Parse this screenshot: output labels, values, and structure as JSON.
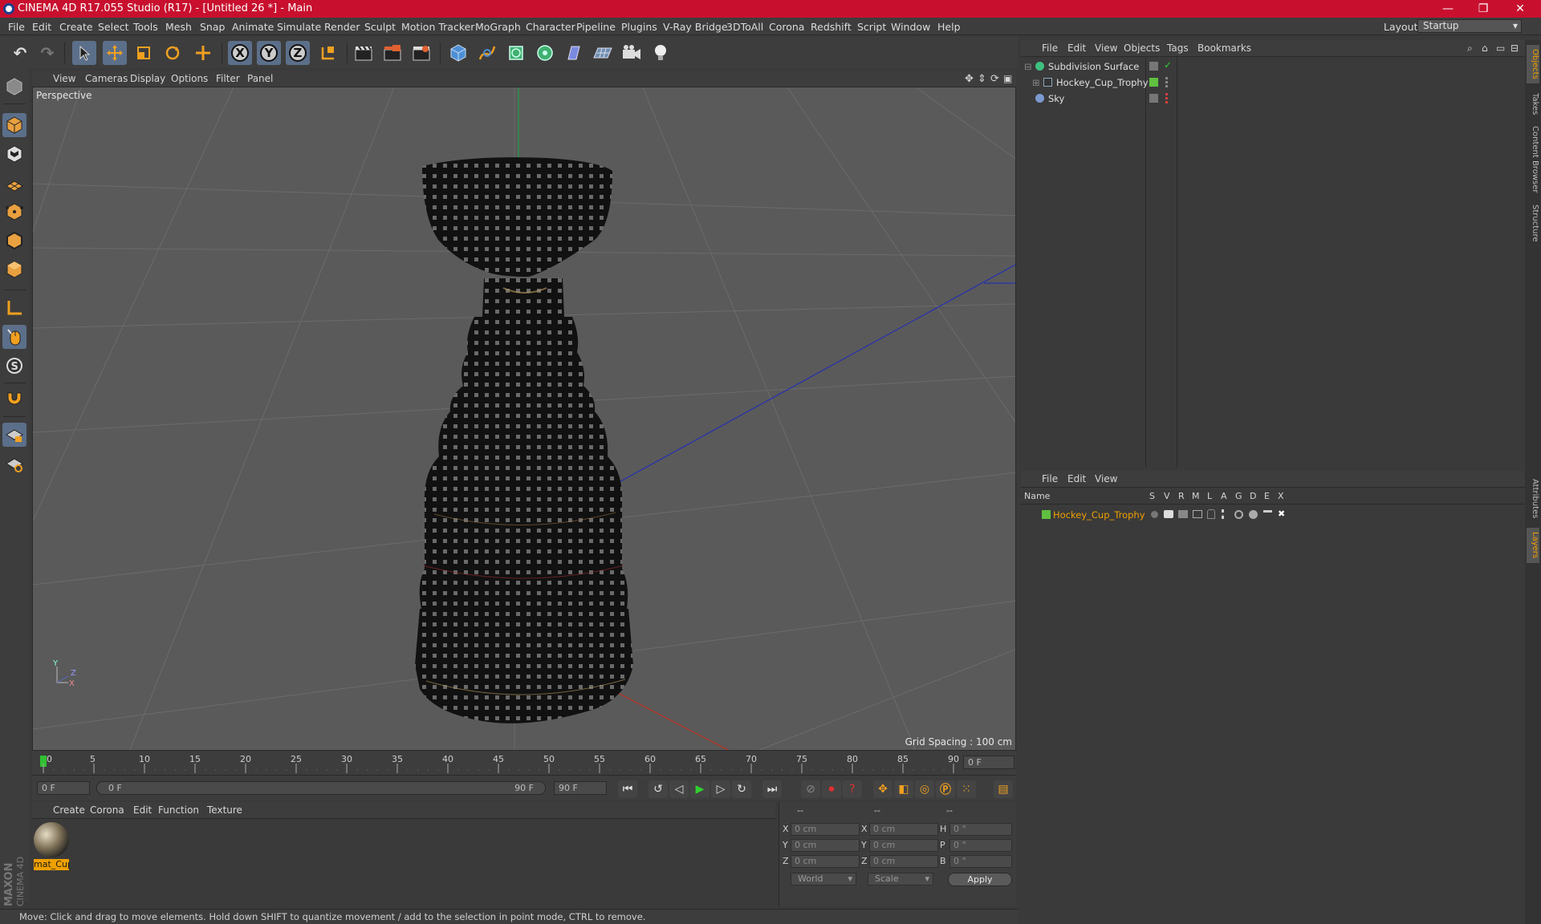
{
  "window": {
    "title": "CINEMA 4D R17.055 Studio (R17) - [Untitled 26 *] - Main",
    "minimize": "—",
    "maximize": "❐",
    "close": "✕"
  },
  "menubar": [
    "File",
    "Edit",
    "Create",
    "Select",
    "Tools",
    "Mesh",
    "Snap",
    "Animate",
    "Simulate",
    "Render",
    "Sculpt",
    "Motion Tracker",
    "MoGraph",
    "Character",
    "Pipeline",
    "Plugins",
    "V-Ray Bridge",
    "3DToAll",
    "Corona",
    "Redshift",
    "Script",
    "Window",
    "Help"
  ],
  "layout": {
    "label": "Layout:",
    "value": "Startup"
  },
  "toolbar": {
    "x_label": "X",
    "y_label": "Y",
    "z_label": "Z"
  },
  "viewport": {
    "menu": [
      "View",
      "Cameras",
      "Display",
      "Options",
      "Filter",
      "Panel"
    ],
    "camera": "Perspective",
    "grid_spacing": "Grid Spacing : 100 cm",
    "axis_x": "X",
    "axis_y": "Y",
    "axis_z": "Z"
  },
  "timeline": {
    "ticks": [
      "0",
      "5",
      "10",
      "15",
      "20",
      "25",
      "30",
      "35",
      "40",
      "45",
      "50",
      "55",
      "60",
      "65",
      "70",
      "75",
      "80",
      "85",
      "90"
    ],
    "current_frame": "0 F",
    "start_field": "0 F",
    "range_start": "0 F",
    "range_end": "90 F",
    "end_field": "90 F"
  },
  "material_manager": {
    "menu": [
      "Create",
      "Corona",
      "Edit",
      "Function",
      "Texture"
    ],
    "material_name": "mat_Cup"
  },
  "coordinates": {
    "header_a": "--",
    "header_b": "--",
    "header_c": "--",
    "rows": [
      {
        "pos_label": "X",
        "pos": "0 cm",
        "size_label": "X",
        "size": "0 cm",
        "rot_label": "H",
        "rot": "0 °"
      },
      {
        "pos_label": "Y",
        "pos": "0 cm",
        "size_label": "Y",
        "size": "0 cm",
        "rot_label": "P",
        "rot": "0 °"
      },
      {
        "pos_label": "Z",
        "pos": "0 cm",
        "size_label": "Z",
        "size": "0 cm",
        "rot_label": "B",
        "rot": "0 °"
      }
    ],
    "mode": "World",
    "scale_mode": "Scale",
    "apply": "Apply"
  },
  "objects_panel": {
    "menu": [
      "File",
      "Edit",
      "View",
      "Objects",
      "Tags",
      "Bookmarks"
    ],
    "items": [
      {
        "name": "Subdivision Surface",
        "color": "#40c080"
      },
      {
        "name": "Hockey_Cup_Trophy",
        "color": "#60c040"
      },
      {
        "name": "Sky",
        "color": "#7a9ad0"
      }
    ]
  },
  "layers_panel": {
    "menu": [
      "File",
      "Edit",
      "View"
    ],
    "headers": [
      "Name",
      "S",
      "V",
      "R",
      "M",
      "L",
      "A",
      "G",
      "D",
      "E",
      "X"
    ],
    "layer_name": "Hockey_Cup_Trophy"
  },
  "side_tabs": [
    "Objects",
    "Takes",
    "Content Browser",
    "Structure",
    "Attributes",
    "Layers"
  ],
  "branding": "MAXON CINEMA 4D",
  "status": "Move: Click and drag to move elements. Hold down SHIFT to quantize movement / add to the selection in point mode, CTRL to remove.",
  "colors": {
    "title_bar": "#c8102e",
    "accent_selected": "#5c6f8a",
    "layer_name": "#f0a000"
  }
}
